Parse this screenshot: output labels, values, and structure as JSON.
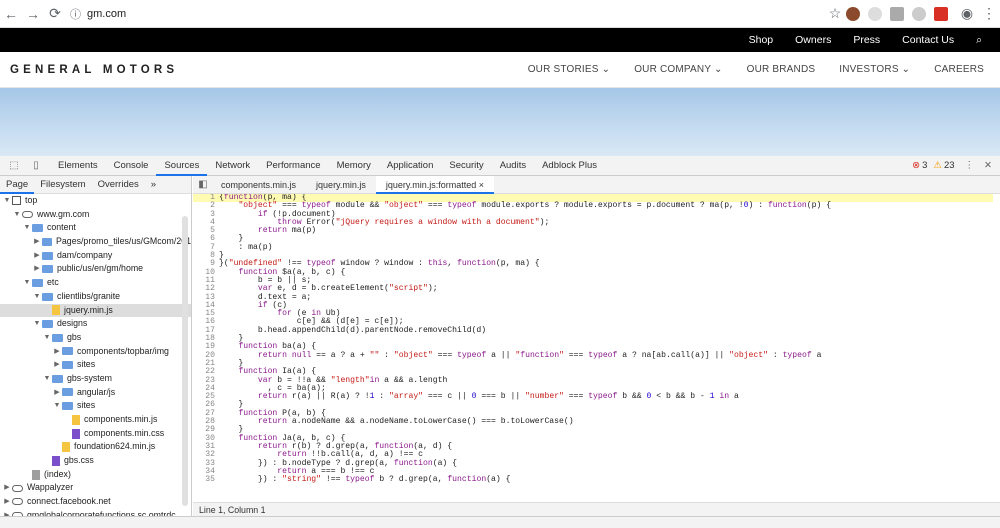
{
  "browser": {
    "url": "gm.com"
  },
  "topbar": {
    "links": [
      "Shop",
      "Owners",
      "Press",
      "Contact Us"
    ]
  },
  "gmnav": {
    "logo": "GENERAL MOTORS",
    "links": [
      "OUR STORIES ⌄",
      "OUR COMPANY ⌄",
      "OUR BRANDS",
      "INVESTORS ⌄",
      "CAREERS"
    ]
  },
  "devtools": {
    "tabs": [
      "Elements",
      "Console",
      "Sources",
      "Network",
      "Performance",
      "Memory",
      "Application",
      "Security",
      "Audits",
      "Adblock Plus"
    ],
    "active_tab": "Sources",
    "errors": "3",
    "warnings": "23"
  },
  "navigator": {
    "tabs": [
      "Page",
      "Filesystem",
      "Overrides",
      "»"
    ],
    "tree": [
      {
        "t": "top",
        "d": 0,
        "i": "box",
        "o": "▼"
      },
      {
        "t": "www.gm.com",
        "d": 1,
        "i": "cloud",
        "o": "▼"
      },
      {
        "t": "content",
        "d": 2,
        "i": "fold",
        "o": "▼"
      },
      {
        "t": "Pages/promo_tiles/us/GMcom/201",
        "d": 3,
        "i": "fold",
        "o": "▶"
      },
      {
        "t": "dam/company",
        "d": 3,
        "i": "fold",
        "o": "▶"
      },
      {
        "t": "public/us/en/gm/home",
        "d": 3,
        "i": "fold",
        "o": "▶"
      },
      {
        "t": "etc",
        "d": 2,
        "i": "fold",
        "o": "▼"
      },
      {
        "t": "clientlibs/granite",
        "d": 3,
        "i": "fold",
        "o": "▼"
      },
      {
        "t": "jquery.min.js",
        "d": 4,
        "i": "file-y",
        "o": "",
        "sel": true
      },
      {
        "t": "designs",
        "d": 3,
        "i": "fold",
        "o": "▼"
      },
      {
        "t": "gbs",
        "d": 4,
        "i": "fold",
        "o": "▼"
      },
      {
        "t": "components/topbar/img",
        "d": 5,
        "i": "fold",
        "o": "▶"
      },
      {
        "t": "sites",
        "d": 5,
        "i": "fold",
        "o": "▶"
      },
      {
        "t": "gbs-system",
        "d": 4,
        "i": "fold",
        "o": "▼"
      },
      {
        "t": "angular/js",
        "d": 5,
        "i": "fold",
        "o": "▶"
      },
      {
        "t": "sites",
        "d": 5,
        "i": "fold",
        "o": "▼"
      },
      {
        "t": "components.min.js",
        "d": 6,
        "i": "file-y",
        "o": ""
      },
      {
        "t": "components.min.css",
        "d": 6,
        "i": "file-p",
        "o": ""
      },
      {
        "t": "foundation624.min.js",
        "d": 5,
        "i": "file-y",
        "o": ""
      },
      {
        "t": "gbs.css",
        "d": 4,
        "i": "file-p",
        "o": ""
      },
      {
        "t": "(index)",
        "d": 2,
        "i": "file-g",
        "o": ""
      },
      {
        "t": "Wappalyzer",
        "d": 0,
        "i": "cloud",
        "o": "▶"
      },
      {
        "t": "connect.facebook.net",
        "d": 0,
        "i": "cloud",
        "o": "▶"
      },
      {
        "t": "gmglobalcorporatefunctions.sc.omtrdc",
        "d": 0,
        "i": "cloud",
        "o": "▶"
      }
    ]
  },
  "editor": {
    "files": [
      "components.min.js",
      "jquery.min.js",
      "jquery.min.js:formatted ×"
    ],
    "status": "Line 1, Column 1"
  },
  "code": [
    "{function(p, ma) {",
    "    \"object\" === typeof module && \"object\" === typeof module.exports ? module.exports = p.document ? ma(p, !0) : function(p) {",
    "        if (!p.document)",
    "            throw Error(\"jQuery requires a window with a document\");",
    "        return ma(p)",
    "    }",
    "    : ma(p)",
    "}",
    "}(\"undefined\" !== typeof window ? window : this, function(p, ma) {",
    "    function $a(a, b, c) {",
    "        b = b || s;",
    "        var e, d = b.createElement(\"script\");",
    "        d.text = a;",
    "        if (c)",
    "            for (e in Ub)",
    "                c[e] && (d[e] = c[e]);",
    "        b.head.appendChild(d).parentNode.removeChild(d)",
    "    }",
    "    function ba(a) {",
    "        return null == a ? a + \"\" : \"object\" === typeof a || \"function\" === typeof a ? na[ab.call(a)] || \"object\" : typeof a",
    "    }",
    "    function Ia(a) {",
    "        var b = !!a && \"length\"in a && a.length",
    "          , c = ba(a);",
    "        return r(a) || R(a) ? !1 : \"array\" === c || 0 === b || \"number\" === typeof b && 0 < b && b - 1 in a",
    "    }",
    "    function P(a, b) {",
    "        return a.nodeName && a.nodeName.toLowerCase() === b.toLowerCase()",
    "    }",
    "    function Ja(a, b, c) {",
    "        return r(b) ? d.grep(a, function(a, d) {",
    "            return !!b.call(a, d, a) !== c",
    "        }) : b.nodeType ? d.grep(a, function(a) {",
    "            return a === b !== c",
    "        }) : \"string\" !== typeof b ? d.grep(a, function(a) {"
  ]
}
